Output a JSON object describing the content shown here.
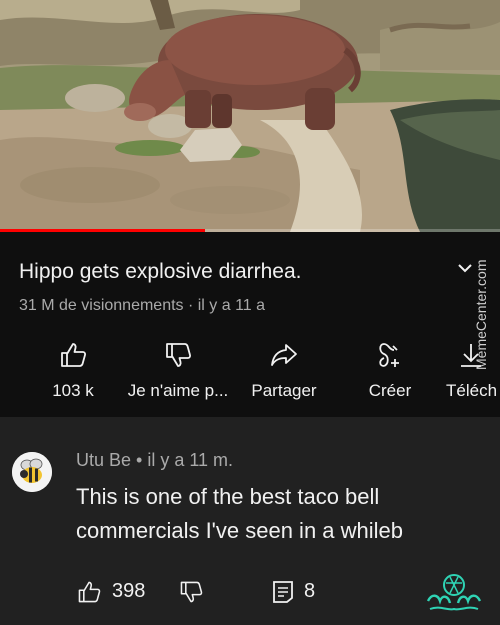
{
  "video": {
    "progress_fraction": 0.41,
    "icon": "hippo-video-frame"
  },
  "info": {
    "title": "Hippo gets explosive diarrhea.",
    "meta": "31 M de visionnements · il y a 11 a",
    "watermark": "MemeCenter.com",
    "actions": [
      {
        "label": "103 k",
        "icon": "thumbs-up-icon"
      },
      {
        "label": "Je n'aime p...",
        "icon": "thumbs-down-icon"
      },
      {
        "label": "Partager",
        "icon": "share-icon"
      },
      {
        "label": "Créer",
        "icon": "create-icon"
      },
      {
        "label": "Téléch",
        "icon": "download-icon"
      }
    ]
  },
  "comment": {
    "author_line": "Utu Be • il y a 11 m.",
    "text": "This is one of the best taco bell commercials I've seen in a whileb",
    "likes": "398",
    "replies": "8",
    "avatar_icon": "bee-icon"
  },
  "colors": {
    "background": "#0f0f0f",
    "comment_background": "#212121",
    "progress": "#ff0000",
    "secondary_text": "#aaaaaa",
    "logo": "#2fd3b4"
  }
}
